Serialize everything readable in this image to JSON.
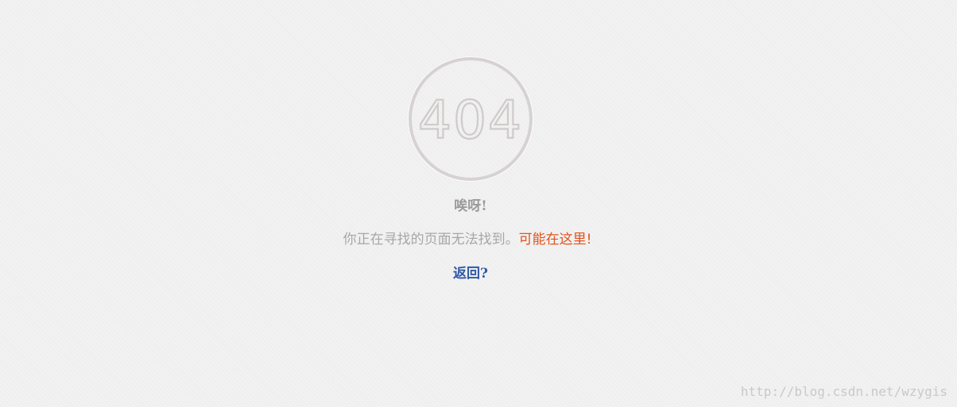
{
  "badge": {
    "text": "404",
    "ring_color": "#d6d2d2",
    "text_color": "#d9d5d5"
  },
  "heading": {
    "text": "唉呀!"
  },
  "message": {
    "prefix": "你正在寻找的页面无法找到。",
    "link": "可能在这里!",
    "link_color": "#e2531c"
  },
  "back_link": {
    "label": "返回?",
    "color": "#2f5aa8"
  },
  "watermark": {
    "text": "http://blog.csdn.net/wzygis"
  }
}
